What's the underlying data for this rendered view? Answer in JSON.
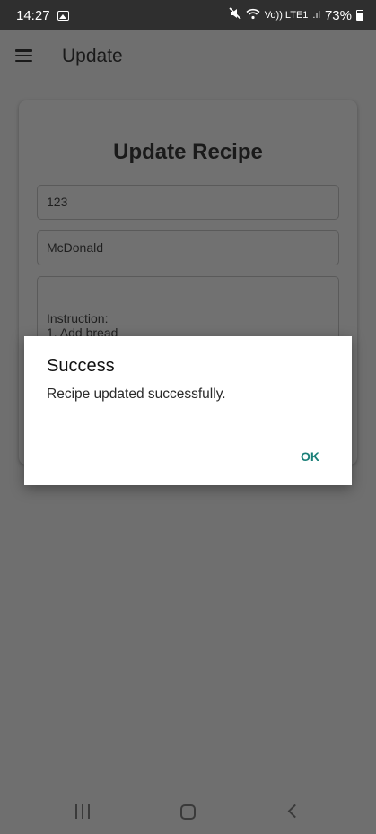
{
  "status_bar": {
    "time": "14:27",
    "network": "Vo)) LTE1",
    "signal": ".ıl",
    "battery": "73%"
  },
  "app_bar": {
    "title": "Update"
  },
  "card": {
    "title": "Update Recipe",
    "field_id": "123",
    "field_name": "McDonald",
    "instruction_line1": "Instruction:",
    "instruction_line2": "1. Add bread"
  },
  "dialog": {
    "title": "Success",
    "message": "Recipe updated successfully.",
    "ok_label": "OK"
  },
  "icons": {
    "menu": "hamburger-menu-icon",
    "gallery": "image-notification-icon",
    "mute": "mute-icon",
    "wifi": "wifi-icon",
    "nav_recents": "recents-icon",
    "nav_home": "home-icon",
    "nav_back": "back-icon"
  },
  "colors": {
    "accent": "#1a7f78",
    "scrim": "#6f6f6f",
    "status_bar": "#2f2f2f"
  }
}
